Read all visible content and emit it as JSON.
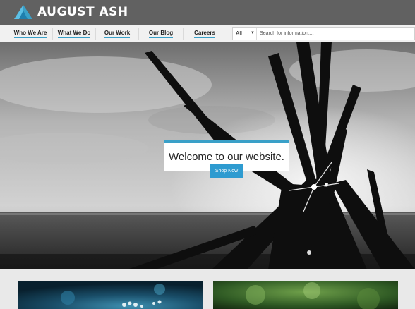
{
  "brand": {
    "name": "AUGUST ASH",
    "logo_icon": "triangle-logo-icon",
    "accent": "#3aa0c8"
  },
  "nav": {
    "items": [
      {
        "label": "Who We Are"
      },
      {
        "label": "What We Do"
      },
      {
        "label": "Our Work"
      },
      {
        "label": "Our Blog"
      },
      {
        "label": "Careers"
      }
    ]
  },
  "search": {
    "scope_value": "All",
    "placeholder": "Search for information...."
  },
  "hero": {
    "headline": "Welcome to our website.",
    "cta_label": "Shop Now"
  },
  "colors": {
    "topbar": "#616161",
    "navbar": "#f1f1f1",
    "button": "#2e9bd0"
  }
}
